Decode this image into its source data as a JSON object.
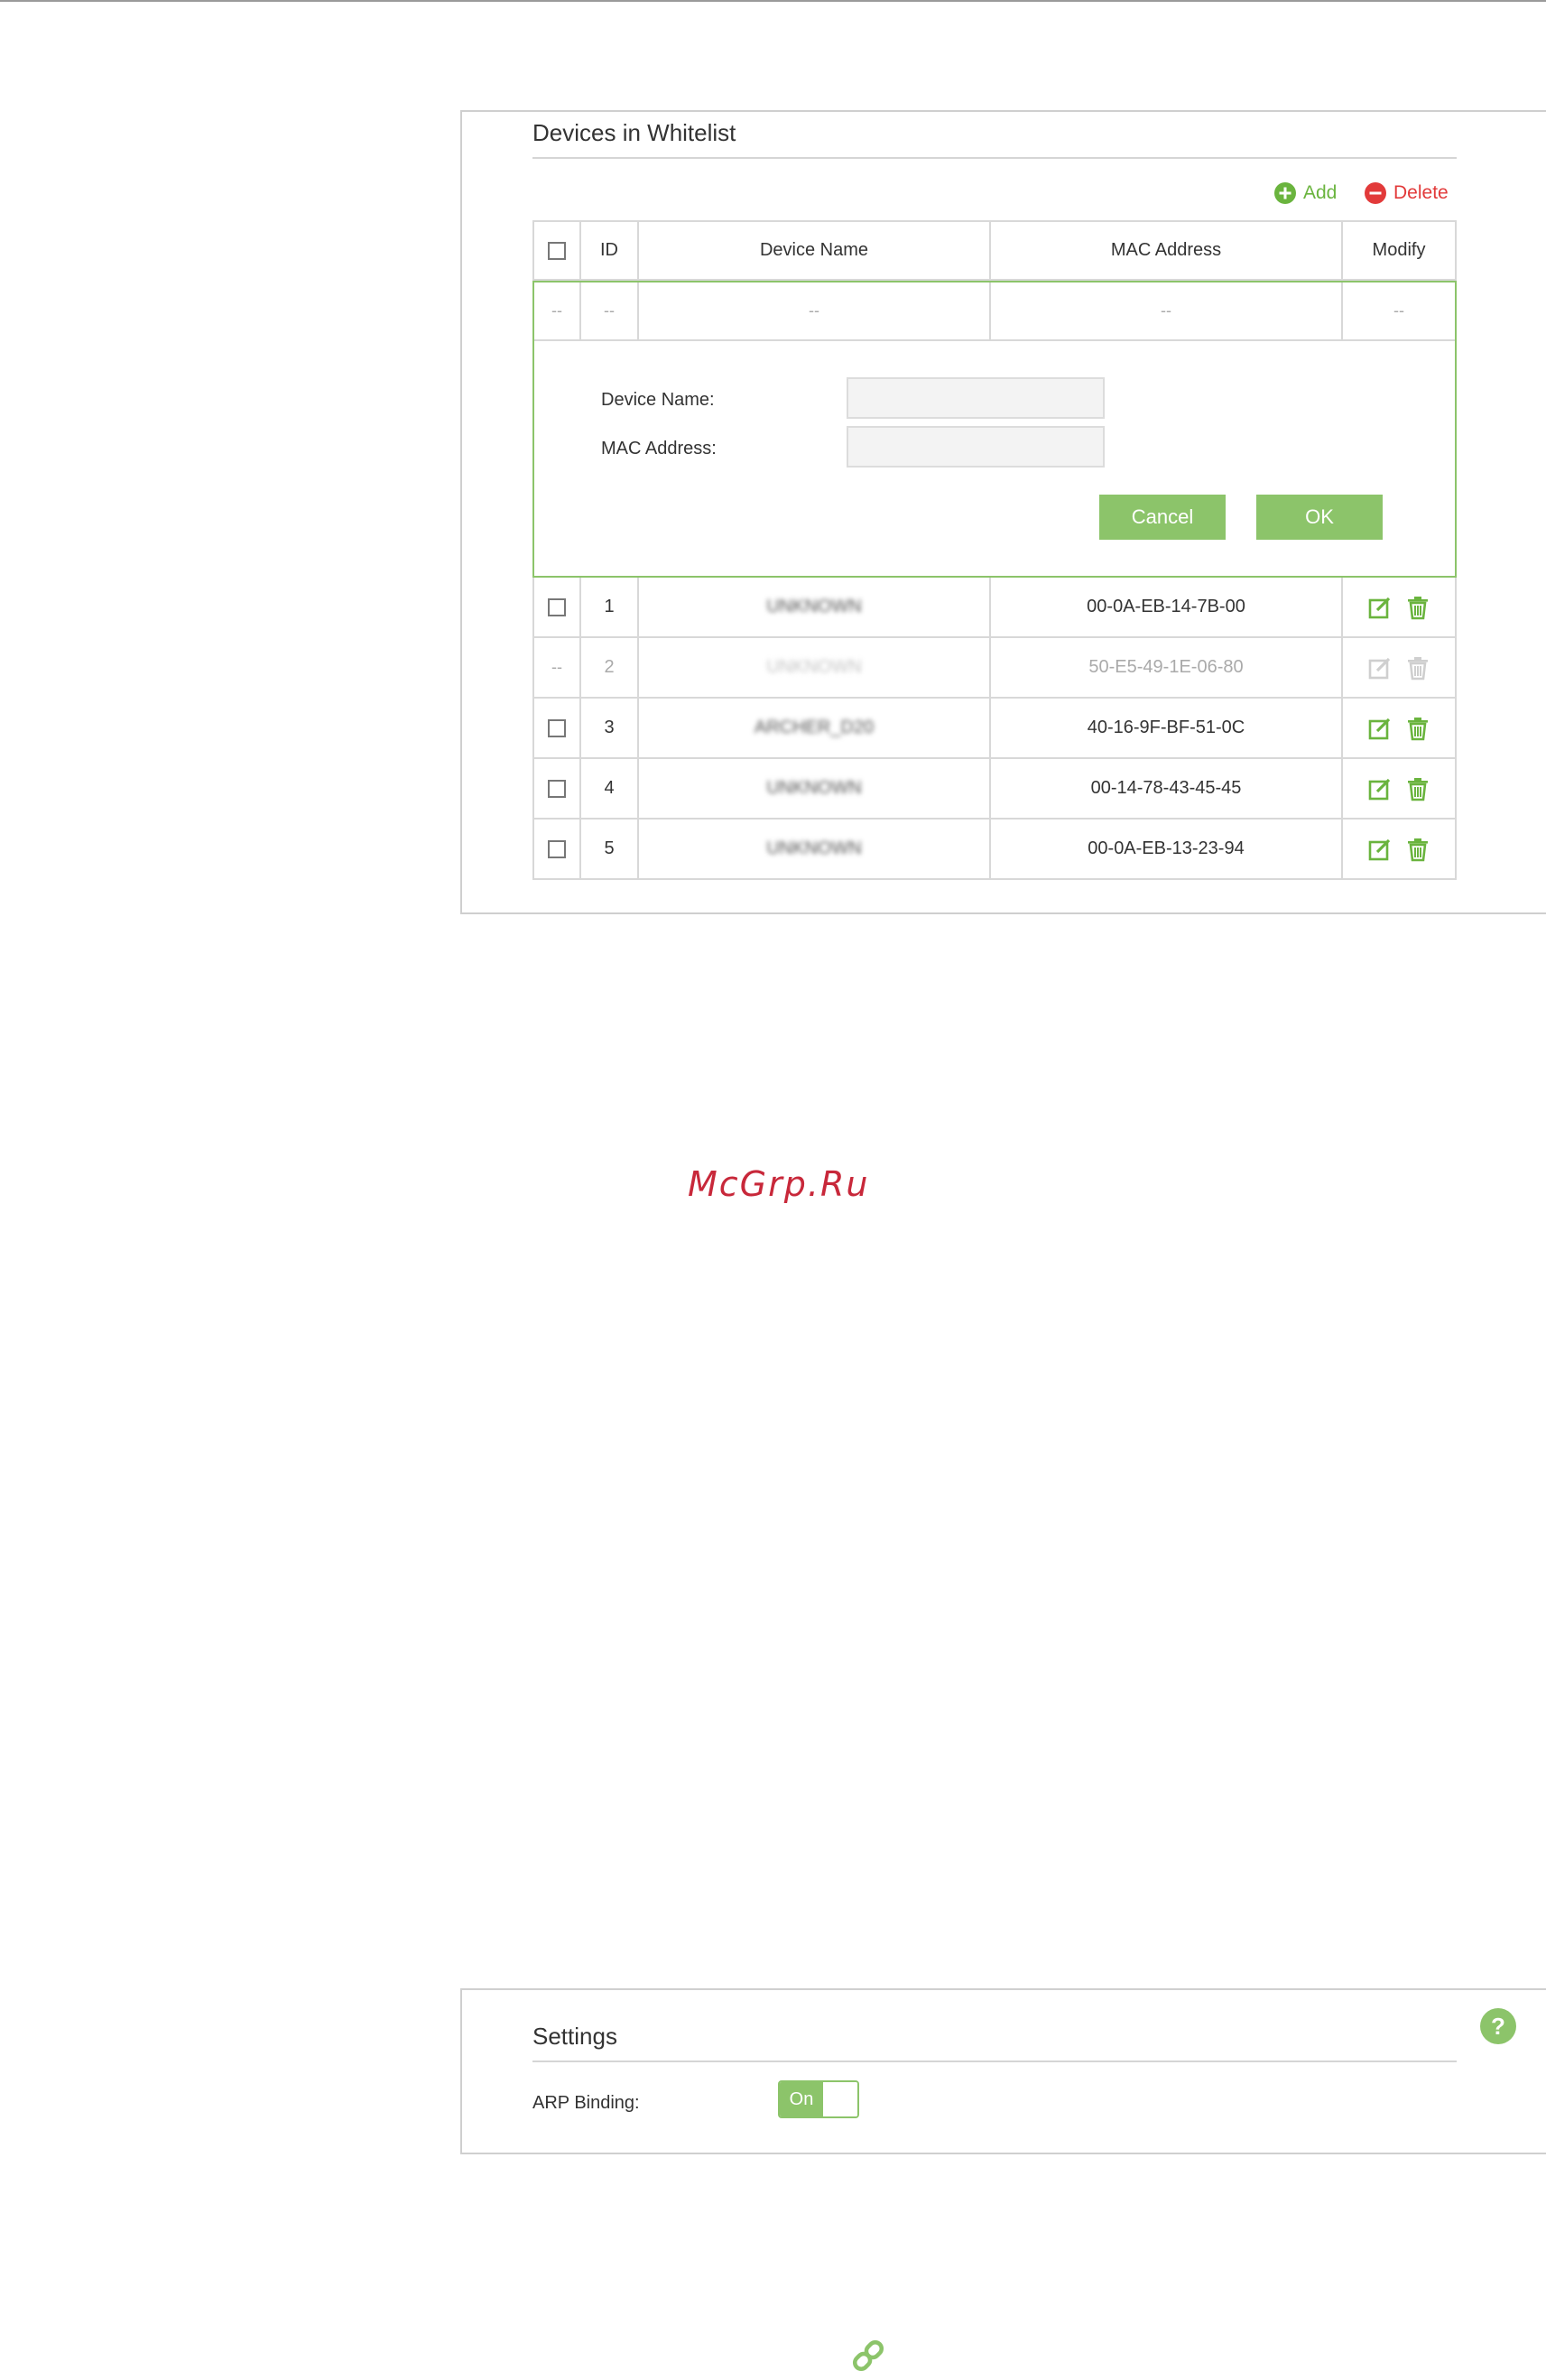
{
  "whitelist": {
    "title": "Devices in Whitelist",
    "add_label": "Add",
    "delete_label": "Delete",
    "columns": {
      "id": "ID",
      "device_name": "Device Name",
      "mac": "MAC Address",
      "modify": "Modify"
    },
    "new_row": {
      "chk": "--",
      "id": "--",
      "name": "--",
      "mac": "--",
      "modify": "--"
    },
    "form": {
      "device_name_label": "Device Name:",
      "mac_label": "MAC Address:",
      "device_name_value": "",
      "mac_value": "",
      "cancel_label": "Cancel",
      "ok_label": "OK"
    },
    "rows": [
      {
        "chk": "",
        "id": "1",
        "name": "UNKNOWN",
        "mac": "00-0A-EB-14-7B-00"
      },
      {
        "chk": "--",
        "id": "2",
        "name": "UNKNOWN",
        "mac": "50-E5-49-1E-06-80"
      },
      {
        "chk": "",
        "id": "3",
        "name": "ARCHER_D20",
        "mac": "40-16-9F-BF-51-0C"
      },
      {
        "chk": "",
        "id": "4",
        "name": "UNKNOWN",
        "mac": "00-14-78-43-45-45"
      },
      {
        "chk": "",
        "id": "5",
        "name": "UNKNOWN",
        "mac": "00-0A-EB-13-23-94"
      }
    ]
  },
  "watermark": {
    "text": "McGrp.Ru"
  },
  "settings": {
    "title": "Settings",
    "help": "?",
    "arp_label": "ARP Binding:",
    "arp_toggle": "On"
  },
  "icons": {
    "add": "plus-circle-icon",
    "delete": "minus-circle-icon",
    "edit": "edit-icon",
    "trash": "trash-icon",
    "help": "question-icon",
    "link": "link-icon"
  },
  "colors": {
    "accent": "#8cc46a",
    "add": "#6ab43e",
    "delete": "#e23a3a",
    "watermark": "#c8283a"
  }
}
